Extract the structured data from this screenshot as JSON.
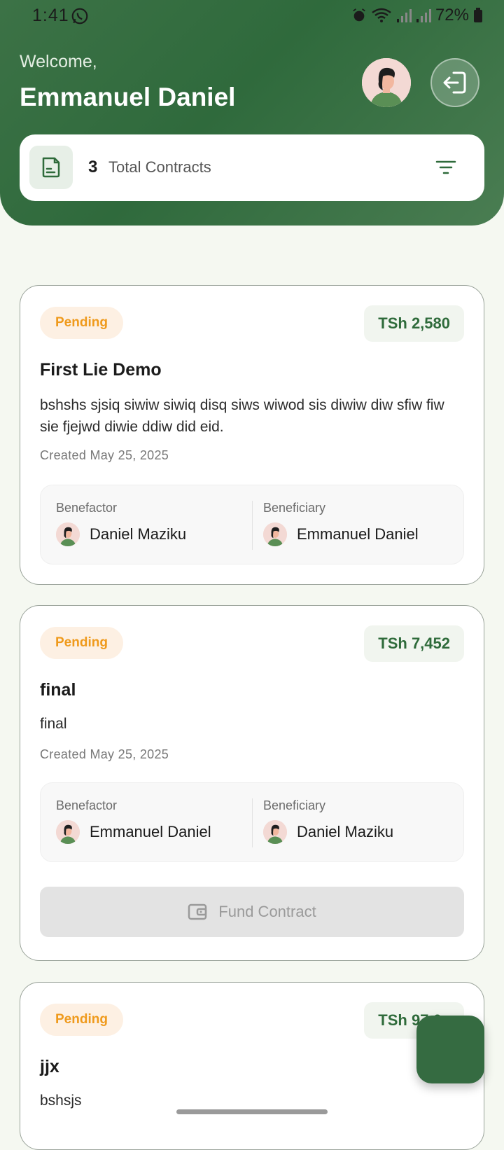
{
  "status_bar": {
    "time": "1:41",
    "battery": "72%"
  },
  "header": {
    "welcome": "Welcome,",
    "user_name": "Emmanuel Daniel",
    "summary": {
      "count": "3",
      "label": "Total Contracts"
    }
  },
  "contracts": [
    {
      "status": "Pending",
      "amount": "TSh 2,580",
      "title": "First Lie Demo",
      "description": "bshshs sjsiq siwiw siwiq disq siws wiwod sis diwiw diw sfiw fiw sie fjejwd diwie ddiw did eid.",
      "created": "Created May 25, 2025",
      "benefactor_label": "Benefactor",
      "benefactor": "Daniel Maziku",
      "beneficiary_label": "Beneficiary",
      "beneficiary": "Emmanuel Daniel"
    },
    {
      "status": "Pending",
      "amount": "TSh 7,452",
      "title": "final",
      "description": "final",
      "created": "Created May 25, 2025",
      "benefactor_label": "Benefactor",
      "benefactor": "Emmanuel Daniel",
      "beneficiary_label": "Beneficiary",
      "beneficiary": "Daniel Maziku",
      "fund_button": "Fund Contract"
    },
    {
      "status": "Pending",
      "amount": "TSh 97,6..",
      "title": "jjx",
      "description": "bshsjs"
    }
  ],
  "colors": {
    "primary": "#356b41",
    "pending": "#ef9a1c",
    "background": "#f5f8f1"
  }
}
